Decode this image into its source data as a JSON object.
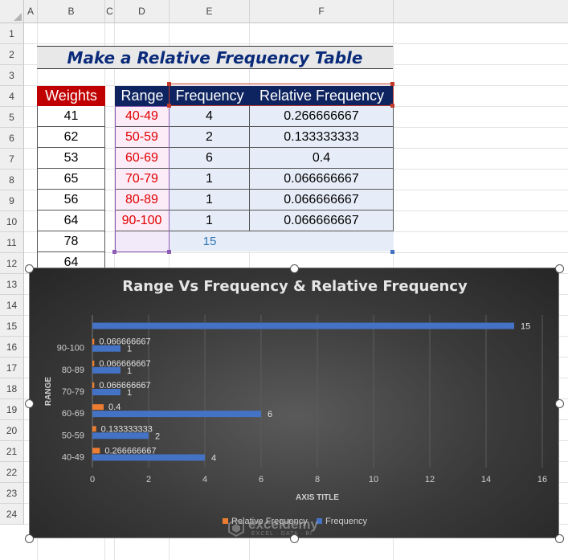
{
  "columns": [
    "A",
    "B",
    "C",
    "D",
    "E",
    "F"
  ],
  "rows": [
    "1",
    "2",
    "3",
    "4",
    "5",
    "6",
    "7",
    "8",
    "9",
    "10",
    "11",
    "12",
    "13",
    "14",
    "15",
    "16",
    "17",
    "18",
    "19",
    "20",
    "21",
    "22",
    "23",
    "24"
  ],
  "title": "Make a Relative Frequency Table",
  "weights": {
    "header": "Weights",
    "values": [
      "41",
      "62",
      "53",
      "65",
      "56",
      "64",
      "78",
      "64"
    ]
  },
  "freq_table": {
    "headers": [
      "Range",
      "Frequency",
      "Relative Frequency"
    ],
    "rows": [
      {
        "range": "40-49",
        "frequency": "4",
        "relative": "0.266666667"
      },
      {
        "range": "50-59",
        "frequency": "2",
        "relative": "0.133333333"
      },
      {
        "range": "60-69",
        "frequency": "6",
        "relative": "0.4"
      },
      {
        "range": "70-79",
        "frequency": "1",
        "relative": "0.066666667"
      },
      {
        "range": "80-89",
        "frequency": "1",
        "relative": "0.066666667"
      },
      {
        "range": "90-100",
        "frequency": "1",
        "relative": "0.066666667"
      }
    ],
    "total": "15"
  },
  "colors": {
    "relative_series": "#ed7d31",
    "frequency_series": "#4472c4",
    "range_text": "#e00000",
    "header_navy": "#0e2460",
    "header_red": "#c00000"
  },
  "chart_data": {
    "type": "bar",
    "orientation": "horizontal",
    "title": "Range Vs Frequency & Relative Frequency",
    "xlabel": "AXIS TITLE",
    "ylabel": "RANGE",
    "categories": [
      "",
      "90-100",
      "80-89",
      "70-79",
      "60-69",
      "50-59",
      "40-49"
    ],
    "series": [
      {
        "name": "Relative Frequency",
        "values": [
          null,
          0.066666667,
          0.066666667,
          0.066666667,
          0.4,
          0.133333333,
          0.266666667
        ],
        "labels": [
          "",
          "0.066666667",
          "0.066666667",
          "0.066666667",
          "0.4",
          "0.133333333",
          "0.266666667"
        ]
      },
      {
        "name": "Frequency",
        "values": [
          15,
          1,
          1,
          1,
          6,
          2,
          4
        ],
        "labels": [
          "15",
          "1",
          "1",
          "1",
          "6",
          "2",
          "4"
        ]
      }
    ],
    "xticks": [
      "0",
      "2",
      "4",
      "6",
      "8",
      "10",
      "12",
      "14",
      "16"
    ],
    "xlim": [
      0,
      16
    ],
    "grid": true,
    "legend": "bottom"
  },
  "watermark": {
    "brand": "exceldemy",
    "tagline": "EXCEL · DATA · BI"
  }
}
